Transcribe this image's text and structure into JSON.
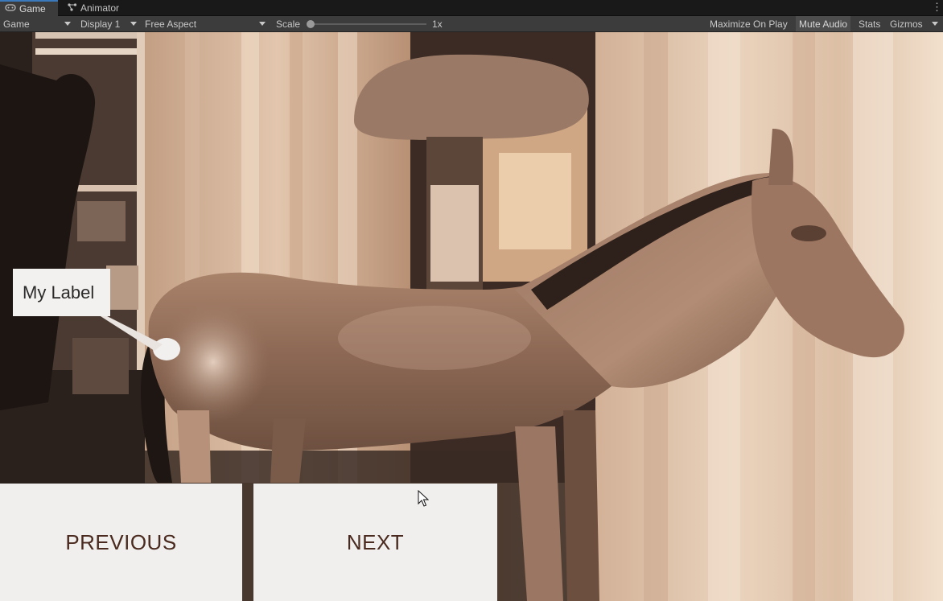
{
  "tabs": [
    {
      "label": "Game",
      "icon": "gamepad-icon",
      "active": true
    },
    {
      "label": "Animator",
      "icon": "animator-icon",
      "active": false
    }
  ],
  "toolbar": {
    "view_mode": "Game",
    "display": "Display 1",
    "aspect": "Free Aspect",
    "scale_label": "Scale",
    "scale_value": "1x",
    "maximize_on_play": "Maximize On Play",
    "mute_audio": "Mute Audio",
    "stats": "Stats",
    "gizmos": "Gizmos"
  },
  "scene": {
    "label_text": "My Label",
    "previous_button": "PREVIOUS",
    "next_button": "NEXT"
  },
  "colors": {
    "accent": "#3a79bb",
    "toolbar_bg": "#3c3c3c",
    "button_bg": "#f0efee",
    "button_text": "#4a2a1e"
  }
}
